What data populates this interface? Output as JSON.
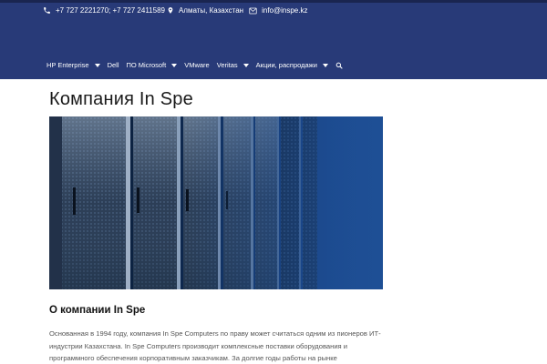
{
  "contacts": {
    "phones": "+7 727 2221270; +7 727 2411589",
    "address": "Алматы, Казахстан",
    "email": "info@inspe.kz"
  },
  "nav": {
    "items": [
      {
        "label": "HP Enterprise",
        "has_dropdown": true
      },
      {
        "label": "Dell",
        "has_dropdown": false
      },
      {
        "label": "ПО Microsoft",
        "has_dropdown": true
      },
      {
        "label": "VMware",
        "has_dropdown": false
      },
      {
        "label": "Veritas",
        "has_dropdown": true
      },
      {
        "label": "Акции, распродажи",
        "has_dropdown": true
      }
    ],
    "search_icon": "search-icon"
  },
  "page": {
    "title": "Компания In Spe",
    "hero_image": "server-racks-photo"
  },
  "about": {
    "heading_bold": "О компании",
    "heading_rest": " In Spe",
    "paragraph": "Основанная в 1994 году, компания In Spe Computers по праву может считаться одним из пионеров ИТ-индустрии Казахстана. In Spe Computers производит комплексные поставки оборудования и программного обеспечения корпоративным заказчикам. За долгие годы работы на рынке"
  },
  "colors": {
    "header_bg": "#283a78",
    "text_white": "#ffffff"
  }
}
